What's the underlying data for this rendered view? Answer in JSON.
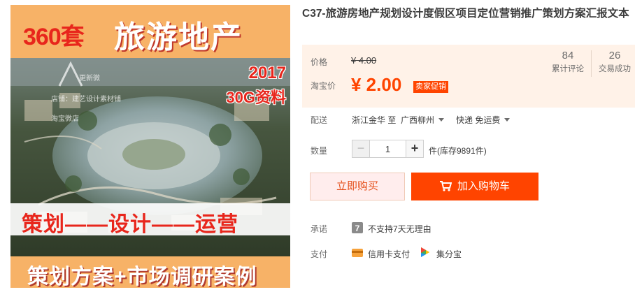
{
  "product_image": {
    "count_text": "360套",
    "topic_text": "旅游地产",
    "year_text": "2017",
    "size_text": "30G资料",
    "watermark_brand": "更新微",
    "watermark_shop": "店铺：建艺设计素材铺",
    "watermark_sub": "淘宝微店",
    "slogan_text": "策划——设计——运营",
    "bottom_text": "策划方案+市场调研案例"
  },
  "title": "C37-旅游房地产规划设计度假区项目定位营销推广策划方案汇报文本",
  "price": {
    "original_label": "价格",
    "original_value": "¥ 4.00",
    "promo_label": "淘宝价",
    "promo_value": "¥ 2.00",
    "promo_badge": "卖家促销"
  },
  "stats": {
    "reviews_count": "84",
    "reviews_label": "累计评论",
    "deals_count": "26",
    "deals_label": "交易成功"
  },
  "delivery": {
    "label": "配送",
    "from": "浙江金华 至",
    "to": "广西柳州",
    "method": "快递 免运费"
  },
  "quantity": {
    "label": "数量",
    "value": "1",
    "minus": "−",
    "plus": "+",
    "stock": "件(库存9891件)"
  },
  "actions": {
    "buy_now": "立即购买",
    "add_to_cart": "加入购物车"
  },
  "promise": {
    "label": "承诺",
    "text": "不支持7天无理由"
  },
  "payment": {
    "label": "支付",
    "credit_card": "信用卡支付",
    "jifenbao": "集分宝"
  },
  "colors": {
    "accent": "#ff4400",
    "price_red": "#ff4400",
    "panel_bg": "#fff2e8",
    "image_orange": "#f7b267"
  }
}
